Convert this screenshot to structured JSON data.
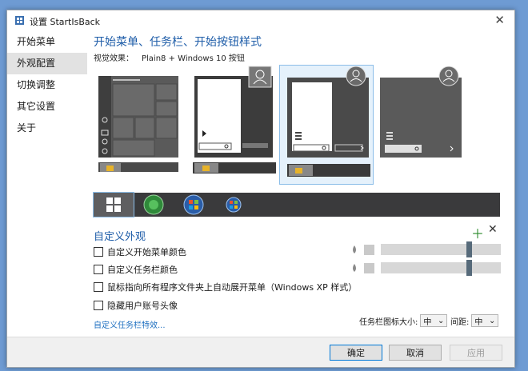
{
  "window": {
    "title": "设置 StartIsBack"
  },
  "nav": {
    "items": [
      "开始菜单",
      "外观配置",
      "切换调整",
      "其它设置",
      "关于"
    ],
    "active_index": 1
  },
  "appearance": {
    "heading": "开始菜单、任务栏、开始按钮样式",
    "preview_label": "视觉效果：",
    "preview_value": "Plain8 + Windows 10 按钮"
  },
  "custom": {
    "title": "自定义外观",
    "checkboxes": [
      "自定义开始菜单颜色",
      "自定义任务栏颜色",
      "鼠标指向所有程序文件夹上自动展开菜单（Windows XP 样式）",
      "隐藏用户账号头像"
    ],
    "taskbar_effects_link": "自定义任务栏特效...",
    "icon_size_label": "任务栏图标大小:",
    "icon_size_value": "中",
    "spacing_label": "间距:",
    "spacing_value": "中",
    "startmenu_slider_level": 0.75,
    "taskbar_slider_level": 0.75
  },
  "buttons": {
    "ok": "确定",
    "cancel": "取消",
    "apply": "应用"
  },
  "colors": {
    "accent": "#1d5ca8",
    "selection": "#8bbde8",
    "taskbar": "#3a3a3c"
  }
}
